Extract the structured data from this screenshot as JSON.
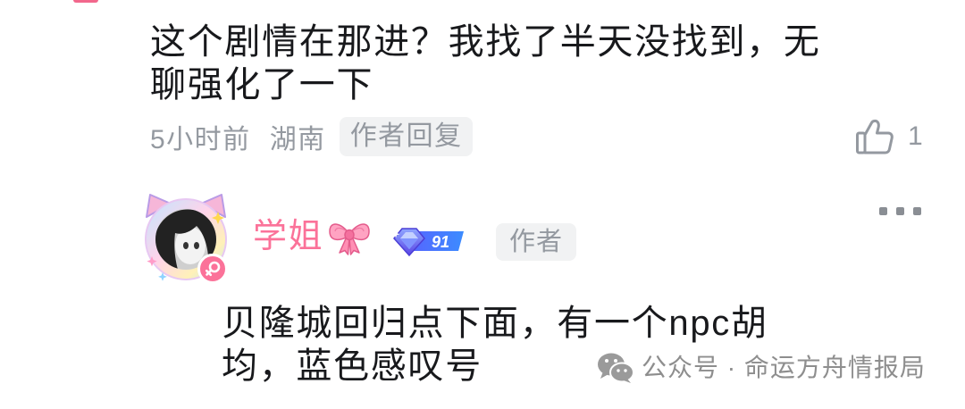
{
  "colors": {
    "text": "#18191c",
    "meta": "#9499a0",
    "badge_bg": "#f1f2f3",
    "accent": "#fb7299"
  },
  "comments": [
    {
      "text": "这个剧情在那进？我找了半天没找到，无聊强化了一下",
      "time": "5小时前",
      "location": "湖南",
      "badge": "作者回复",
      "like_icon": "thumbs-up-icon",
      "likes": 1
    },
    {
      "author": {
        "name": "学姐",
        "name_emoji_icon": "bow-emoji-icon",
        "gender_icon": "female-icon",
        "level": 91,
        "badge": "作者"
      },
      "more_icon": "more-icon",
      "text": "贝隆城回归点下面，有一个npc胡均，蓝色感叹号"
    }
  ],
  "watermark": {
    "icon": "wechat-icon",
    "text": "公众号 · 命运方舟情报局"
  }
}
